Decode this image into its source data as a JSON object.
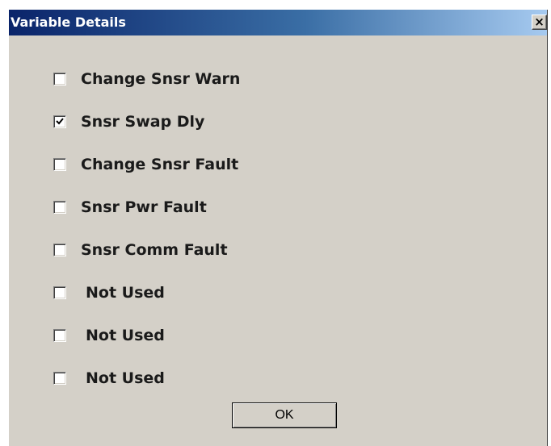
{
  "window": {
    "title": "Variable Details",
    "close_label": "×"
  },
  "options": [
    {
      "label": "Change Snsr Warn",
      "checked": false
    },
    {
      "label": "Snsr Swap Dly",
      "checked": true
    },
    {
      "label": "Change Snsr Fault",
      "checked": false
    },
    {
      "label": "Snsr Pwr Fault",
      "checked": false
    },
    {
      "label": "Snsr Comm Fault",
      "checked": false
    },
    {
      "label": "Not Used",
      "checked": false
    },
    {
      "label": "Not Used",
      "checked": false
    },
    {
      "label": "Not Used",
      "checked": false
    }
  ],
  "buttons": {
    "ok_label": "OK"
  }
}
